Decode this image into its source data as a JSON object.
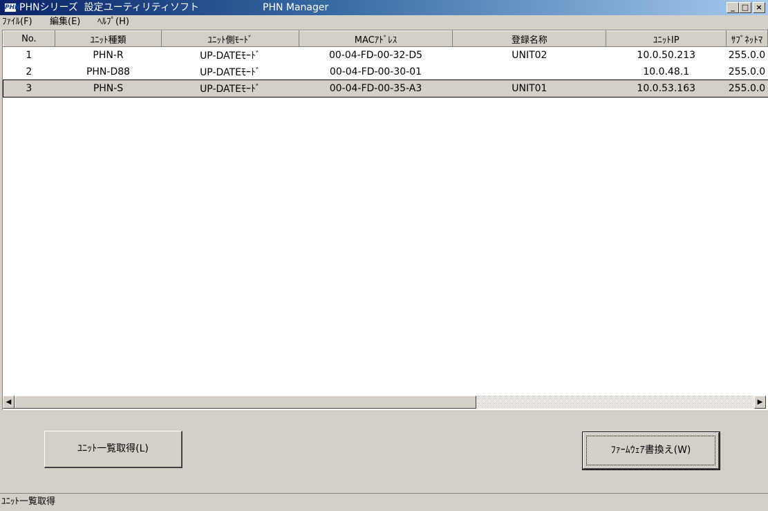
{
  "window": {
    "logo_text": "PHN",
    "title": "PHNシリーズ  設定ユーティリティソフト",
    "app_name": "PHN Manager",
    "minimize_glyph": "_",
    "maximize_glyph": "□",
    "close_glyph": "×"
  },
  "menu": {
    "items": [
      {
        "label": "ﾌｧｲﾙ(F)"
      },
      {
        "label": "編集(E)"
      },
      {
        "label": "ﾍﾙﾌﾟ(H)"
      }
    ]
  },
  "table": {
    "columns": [
      "No.",
      "ﾕﾆｯﾄ種類",
      "ﾕﾆｯﾄ側ﾓｰﾄﾞ",
      "MACｱﾄﾞﾚｽ",
      "登録名称",
      "ﾕﾆｯﾄIP",
      "ｻﾌﾞﾈｯﾄﾏ"
    ],
    "rows": [
      {
        "no": "1",
        "type": "PHN-R",
        "mode": "UP-DATEﾓｰﾄﾞ",
        "mac": "00-04-FD-00-32-D5",
        "name": "UNIT02",
        "ip": "10.0.50.213",
        "subnet": "255.0.0"
      },
      {
        "no": "2",
        "type": "PHN-D88",
        "mode": "UP-DATEﾓｰﾄﾞ",
        "mac": "00-04-FD-00-30-01",
        "name": "",
        "ip": "10.0.48.1",
        "subnet": "255.0.0"
      },
      {
        "no": "3",
        "type": "PHN-S",
        "mode": "UP-DATEﾓｰﾄﾞ",
        "mac": "00-04-FD-00-35-A3",
        "name": "UNIT01",
        "ip": "10.0.53.163",
        "subnet": "255.0.0"
      }
    ],
    "selected_row": 3
  },
  "scrollbar": {
    "left_arrow": "◀",
    "right_arrow": "▶"
  },
  "buttons": {
    "get_list": "ﾕﾆｯﾄ一覧取得(L)",
    "firmware_update": "ﾌｧｰﾑｳｪｱ書換え(W)"
  },
  "status": {
    "text": "ﾕﾆｯﾄ一覧取得"
  }
}
